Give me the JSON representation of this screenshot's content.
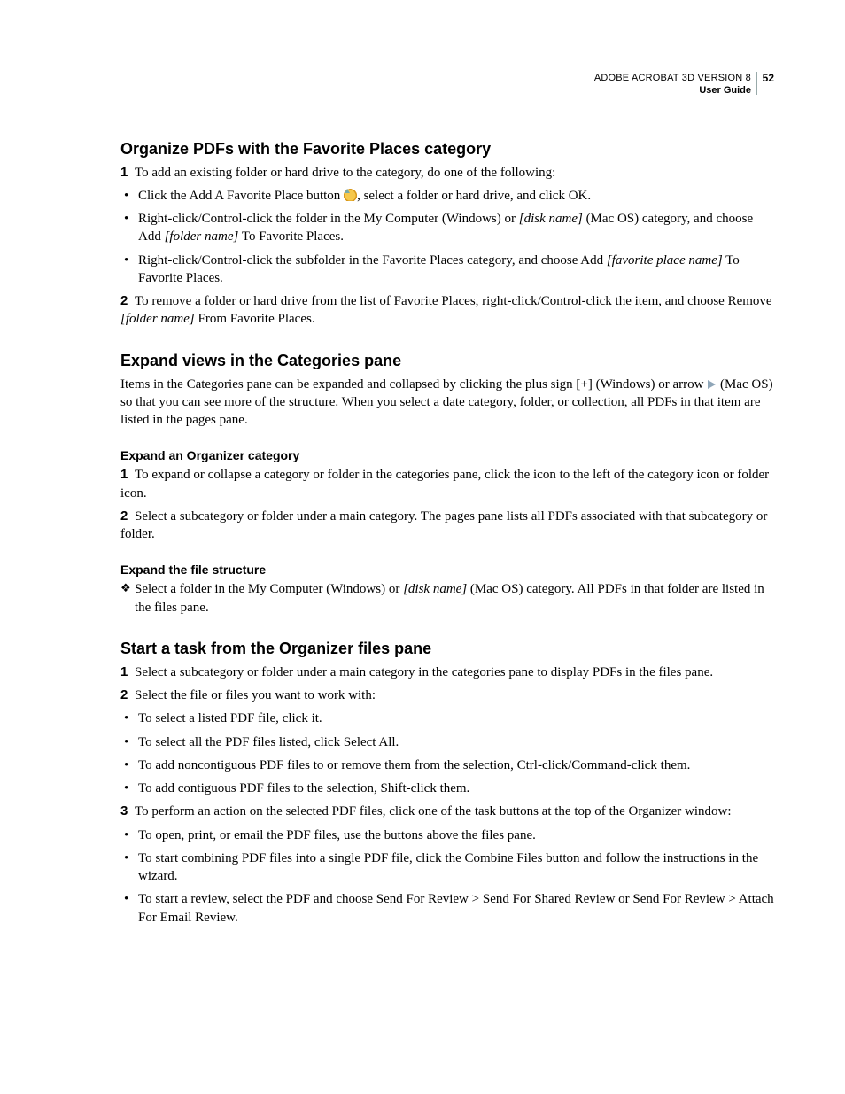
{
  "header": {
    "line1": "ADOBE ACROBAT 3D VERSION 8",
    "line2": "User Guide",
    "page_number": "52"
  },
  "sections": [
    {
      "title": "Organize PDFs with the Favorite Places category",
      "blocks": [
        {
          "type": "step",
          "num": "1",
          "text": "To add an existing folder or hard drive to the category, do one of the following:"
        },
        {
          "type": "bullet",
          "pre": "Click the Add A Favorite Place button ",
          "icon": "favstar",
          "post": ", select a folder or hard drive, and click OK."
        },
        {
          "type": "bullet",
          "pre": "Right-click/Control-click the folder in the My Computer (Windows) or ",
          "ital": "[disk name]",
          "post": " (Mac OS) category, and choose Add ",
          "ital2": "[folder name]",
          "post2": " To Favorite Places."
        },
        {
          "type": "bullet",
          "pre": "Right-click/Control-click the subfolder in the Favorite Places category, and choose Add ",
          "ital": "[favorite place name]",
          "post": " To Favorite Places."
        },
        {
          "type": "step",
          "num": "2",
          "pre": "To remove a folder or hard drive from the list of Favorite Places, right-click/Control-click the item, and choose Remove ",
          "ital": "[folder name]",
          "post": " From Favorite Places."
        }
      ]
    },
    {
      "title": "Expand views in the Categories pane",
      "blocks": [
        {
          "type": "body",
          "pre": "Items in the Categories pane can be expanded and collapsed by clicking the plus sign [+] (Windows) or arrow ",
          "icon": "arrow",
          "post": " (Mac OS) so that you can see more of the structure. When you select a date category, folder, or collection, all PDFs in that item are listed in the pages pane."
        }
      ],
      "subsections": [
        {
          "title": "Expand an Organizer category",
          "blocks": [
            {
              "type": "step",
              "num": "1",
              "text": "To expand or collapse a category or folder in the categories pane, click the icon to the left of the category icon or folder icon."
            },
            {
              "type": "step",
              "num": "2",
              "text": "Select a subcategory or folder under a main category. The pages pane lists all PDFs associated with that subcategory or folder."
            }
          ]
        },
        {
          "title": "Expand the file structure",
          "blocks": [
            {
              "type": "diamond",
              "pre": "Select a folder in the My Computer (Windows) or ",
              "ital": "[disk name]",
              "post": " (Mac OS) category. All PDFs in that folder are listed in the files pane."
            }
          ]
        }
      ]
    },
    {
      "title": "Start a task from the Organizer files pane",
      "blocks": [
        {
          "type": "step",
          "num": "1",
          "text": "Select a subcategory or folder under a main category in the categories pane to display PDFs in the files pane."
        },
        {
          "type": "step",
          "num": "2",
          "text": "Select the file or files you want to work with:"
        },
        {
          "type": "bullet",
          "text": "To select a listed PDF file, click it."
        },
        {
          "type": "bullet",
          "text": "To select all the PDF files listed, click Select All."
        },
        {
          "type": "bullet",
          "text": "To add noncontiguous PDF files to or remove them from the selection, Ctrl-click/Command-click them."
        },
        {
          "type": "bullet",
          "text": "To add contiguous PDF files to the selection, Shift-click them."
        },
        {
          "type": "step",
          "num": "3",
          "text": "To perform an action on the selected PDF files, click one of the task buttons at the top of the Organizer window:"
        },
        {
          "type": "bullet",
          "text": "To open, print, or email the PDF files, use the buttons above the files pane."
        },
        {
          "type": "bullet",
          "text": "To start combining PDF files into a single PDF file, click the Combine Files button and follow the instructions in the wizard."
        },
        {
          "type": "bullet",
          "text": "To start a review, select the PDF and choose Send For Review > Send For Shared Review or Send For Review > Attach For Email Review."
        }
      ]
    }
  ]
}
